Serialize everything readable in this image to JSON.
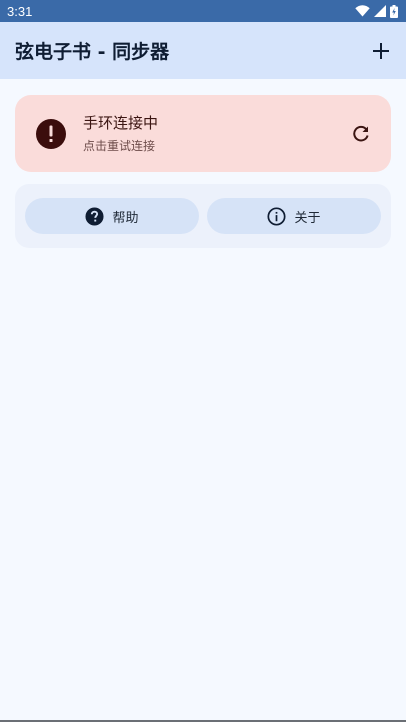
{
  "status_bar": {
    "time": "3:31",
    "icons": [
      "wifi-icon",
      "cellular-icon",
      "battery-charging-icon"
    ]
  },
  "app_bar": {
    "title": "弦电子书 - 同步器",
    "action_icon": "add-icon"
  },
  "alert": {
    "title": "手环连接中",
    "subtitle": "点击重试连接",
    "icon": "error-icon",
    "action_icon": "refresh-icon"
  },
  "actions": {
    "help": {
      "label": "帮助",
      "icon": "help-icon"
    },
    "about": {
      "label": "关于",
      "icon": "info-icon"
    }
  },
  "colors": {
    "status_bar": "#3a6aa8",
    "app_bar": "#d6e4fb",
    "background": "#f5f9ff",
    "alert_bg": "#fadcda",
    "alert_icon": "#3b0d0c",
    "actions_bg": "#ecf1fb",
    "pill_bg": "#d6e3f7"
  }
}
